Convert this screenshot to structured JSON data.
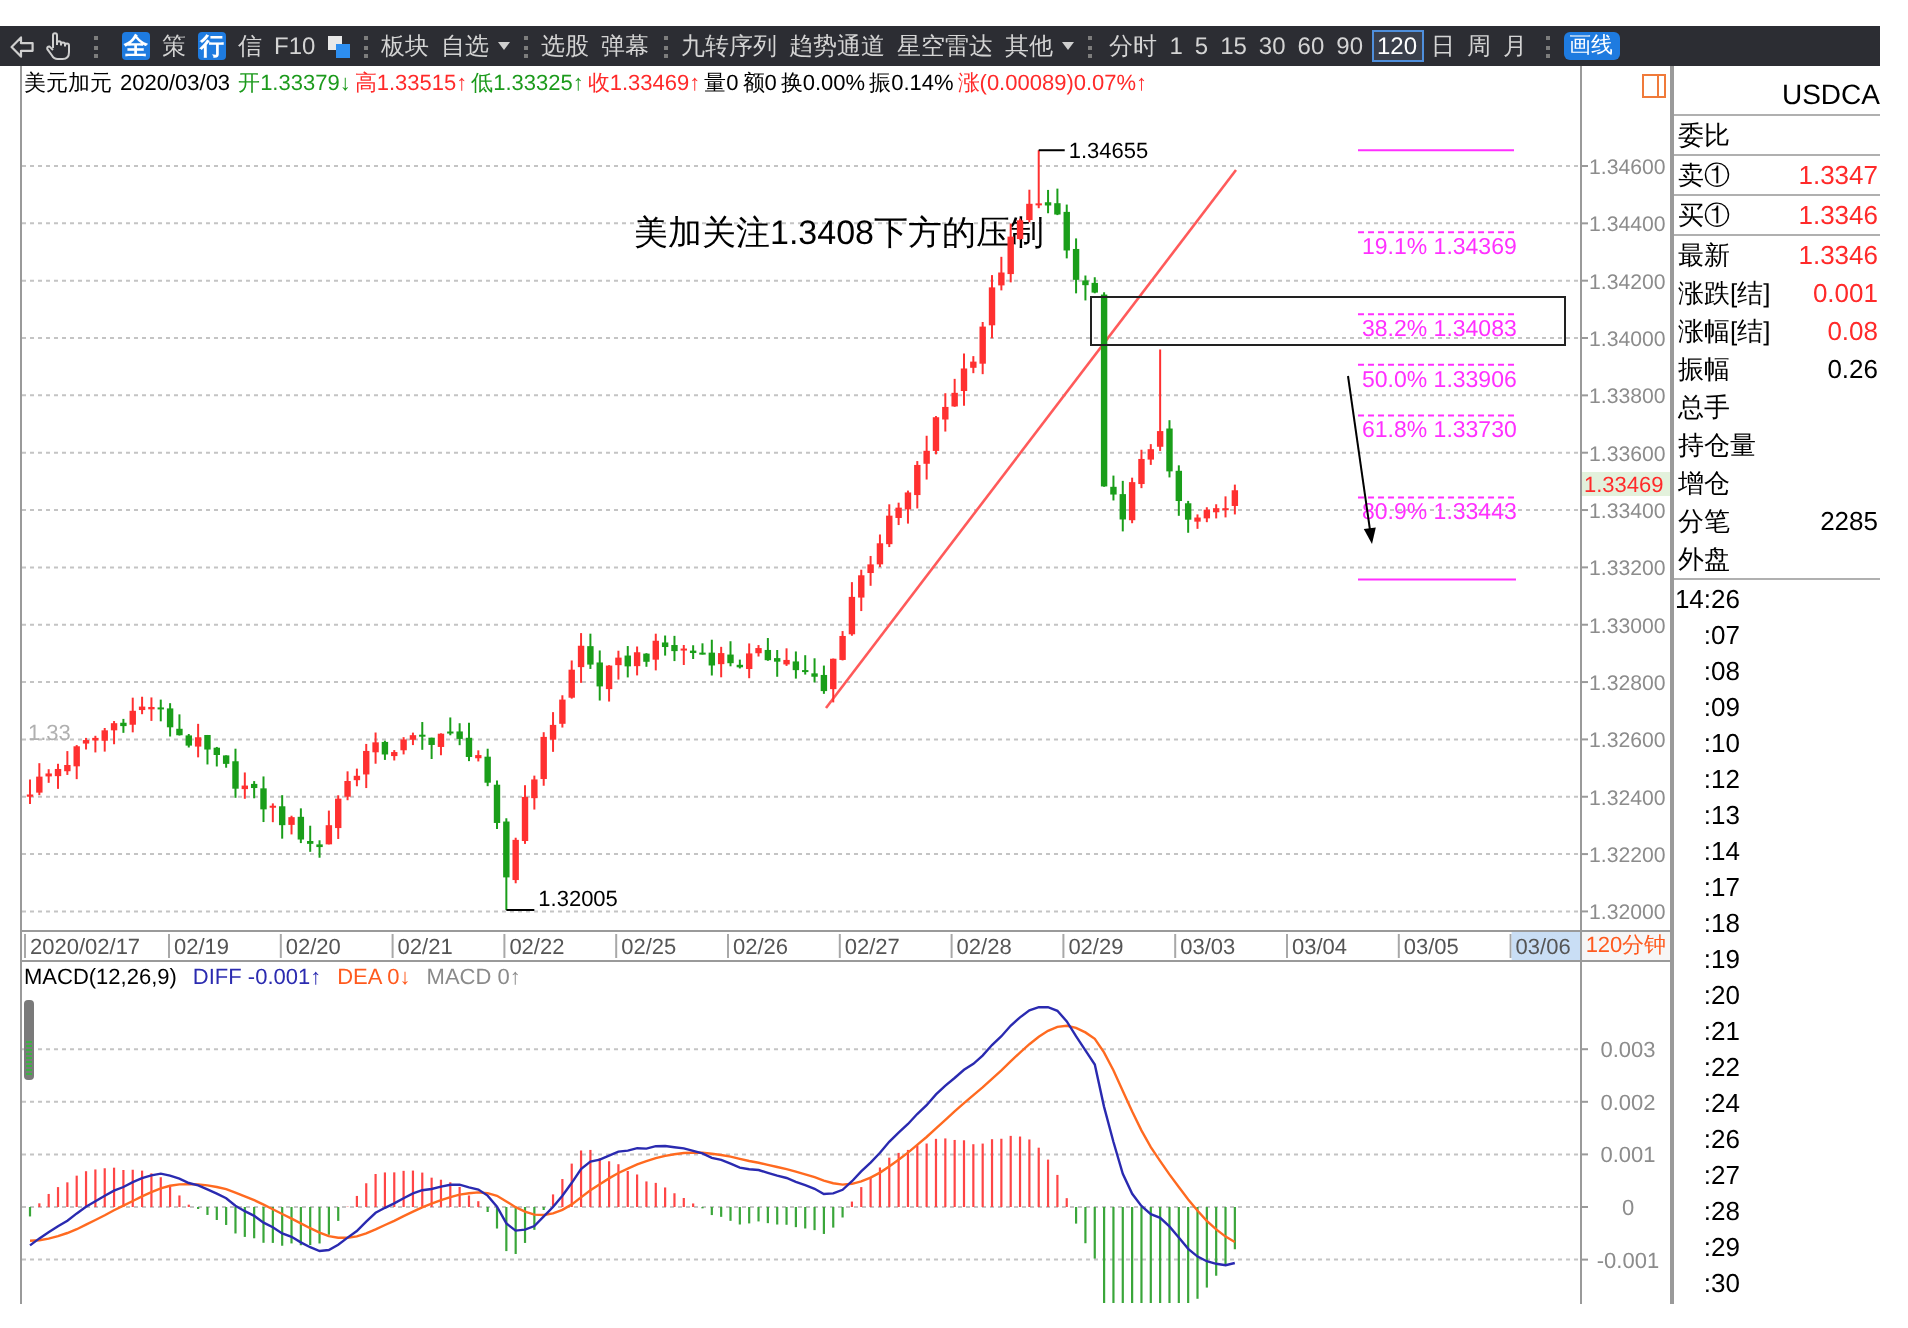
{
  "toolbar": {
    "quick": [
      {
        "label": "全",
        "kind": "pill"
      },
      {
        "label": "策",
        "kind": "plain"
      },
      {
        "label": "行",
        "kind": "pill"
      },
      {
        "label": "信",
        "kind": "plain"
      },
      {
        "label": "F10",
        "kind": "plain"
      }
    ],
    "groups": [
      [
        {
          "label": "板块",
          "dropdown": false
        },
        {
          "label": "自选",
          "dropdown": true
        }
      ],
      [
        {
          "label": "选股",
          "dropdown": false
        },
        {
          "label": "弹幕",
          "dropdown": false
        }
      ],
      [
        {
          "label": "九转序列",
          "dropdown": false
        },
        {
          "label": "趋势通道",
          "dropdown": false
        },
        {
          "label": "星空雷达",
          "dropdown": false
        },
        {
          "label": "其他",
          "dropdown": true
        }
      ]
    ],
    "periods": [
      {
        "label": "分时",
        "selected": false
      },
      {
        "label": "1",
        "selected": false
      },
      {
        "label": "5",
        "selected": false
      },
      {
        "label": "15",
        "selected": false
      },
      {
        "label": "30",
        "selected": false
      },
      {
        "label": "60",
        "selected": false
      },
      {
        "label": "90",
        "selected": false
      },
      {
        "label": "120",
        "selected": true
      },
      {
        "label": "日",
        "selected": false
      },
      {
        "label": "周",
        "selected": false
      },
      {
        "label": "月",
        "selected": false
      }
    ],
    "draw_button": "画线"
  },
  "quote": {
    "name": "美元加元",
    "date": "2020/03/03",
    "fields": [
      {
        "text": "开1.33379↓",
        "color": "#1c9a1c"
      },
      {
        "text": "高1.33515↑",
        "color": "#ff2a2a"
      },
      {
        "text": "低1.33325↑",
        "color": "#1c9a1c"
      },
      {
        "text": "收1.33469↑",
        "color": "#ff2a2a"
      },
      {
        "text": "量0",
        "color": "#000000"
      },
      {
        "text": "额0",
        "color": "#000000"
      },
      {
        "text": "换0.00%",
        "color": "#000000"
      },
      {
        "text": "振0.14%",
        "color": "#000000"
      },
      {
        "text": "涨(0.00089)0.07%↑",
        "color": "#ff2a2a"
      }
    ]
  },
  "chart": {
    "annotation": "美加关注1.3408下方的压制",
    "high_label": "1.34655",
    "low_label": "1.32005",
    "side_label": "1.33",
    "fib_levels": [
      "19.1% 1.34369",
      "38.2% 1.34083",
      "50.0% 1.33906",
      "61.8% 1.33730",
      "80.9% 1.33443"
    ],
    "dates": [
      {
        "label": "2020/02/17",
        "highlighted": false
      },
      {
        "label": "02/19",
        "highlighted": false
      },
      {
        "label": "02/20",
        "highlighted": false
      },
      {
        "label": "02/21",
        "highlighted": false
      },
      {
        "label": "02/22",
        "highlighted": false
      },
      {
        "label": "02/25",
        "highlighted": false
      },
      {
        "label": "02/26",
        "highlighted": false
      },
      {
        "label": "02/27",
        "highlighted": false
      },
      {
        "label": "02/28",
        "highlighted": false
      },
      {
        "label": "02/29",
        "highlighted": false
      },
      {
        "label": "03/03",
        "highlighted": false
      },
      {
        "label": "03/04",
        "highlighted": false
      },
      {
        "label": "03/05",
        "highlighted": false
      },
      {
        "label": "03/06",
        "highlighted": true
      }
    ]
  },
  "price_axis": {
    "ticks": [
      "1.34600",
      "1.34400",
      "1.34200",
      "1.34000",
      "1.33800",
      "1.33600",
      "1.33400",
      "1.33200",
      "1.33000",
      "1.32800",
      "1.32600",
      "1.32400",
      "1.32200",
      "1.32000"
    ],
    "current_price": "1.33469",
    "period_label": "120分钟"
  },
  "macd": {
    "title": "MACD(12,26,9)",
    "fields": [
      {
        "text": "DIFF -0.001↑",
        "color": "#2b2bb0"
      },
      {
        "text": "DEA 0↓",
        "color": "#ff5a1e"
      },
      {
        "text": "MACD 0↑",
        "color": "#8a8a8a"
      }
    ],
    "ticks": [
      "0.003",
      "0.002",
      "0.001",
      "0",
      "-0.001"
    ]
  },
  "quote_panel": {
    "symbol": "USDCA",
    "row_groups": [
      [
        {
          "label": "委比"
        }
      ],
      [
        {
          "label": "卖①",
          "value": "1.3347",
          "color": "#ff2a2a"
        }
      ],
      [
        {
          "label": "买①",
          "value": "1.3346",
          "color": "#ff2a2a"
        }
      ],
      [
        {
          "label": "最新",
          "value": "1.3346",
          "color": "#ff2a2a"
        },
        {
          "label": "涨跌[结]",
          "value": "0.001",
          "color": "#ff2a2a"
        },
        {
          "label": "涨幅[结]",
          "value": "0.08",
          "color": "#ff2a2a"
        },
        {
          "label": "振幅",
          "value": "0.26",
          "color": "#000000"
        },
        {
          "label": "总手"
        },
        {
          "label": "持仓量"
        },
        {
          "label": "增仓"
        },
        {
          "label": "分笔",
          "value": "2285",
          "color": "#000000"
        },
        {
          "label": "外盘"
        }
      ]
    ],
    "times": [
      "14:26",
      ":07",
      ":08",
      ":09",
      ":10",
      ":12",
      ":13",
      ":14",
      ":17",
      ":18",
      ":19",
      ":20",
      ":21",
      ":22",
      ":24",
      ":26",
      ":27",
      ":28",
      ":29",
      ":30"
    ]
  }
}
